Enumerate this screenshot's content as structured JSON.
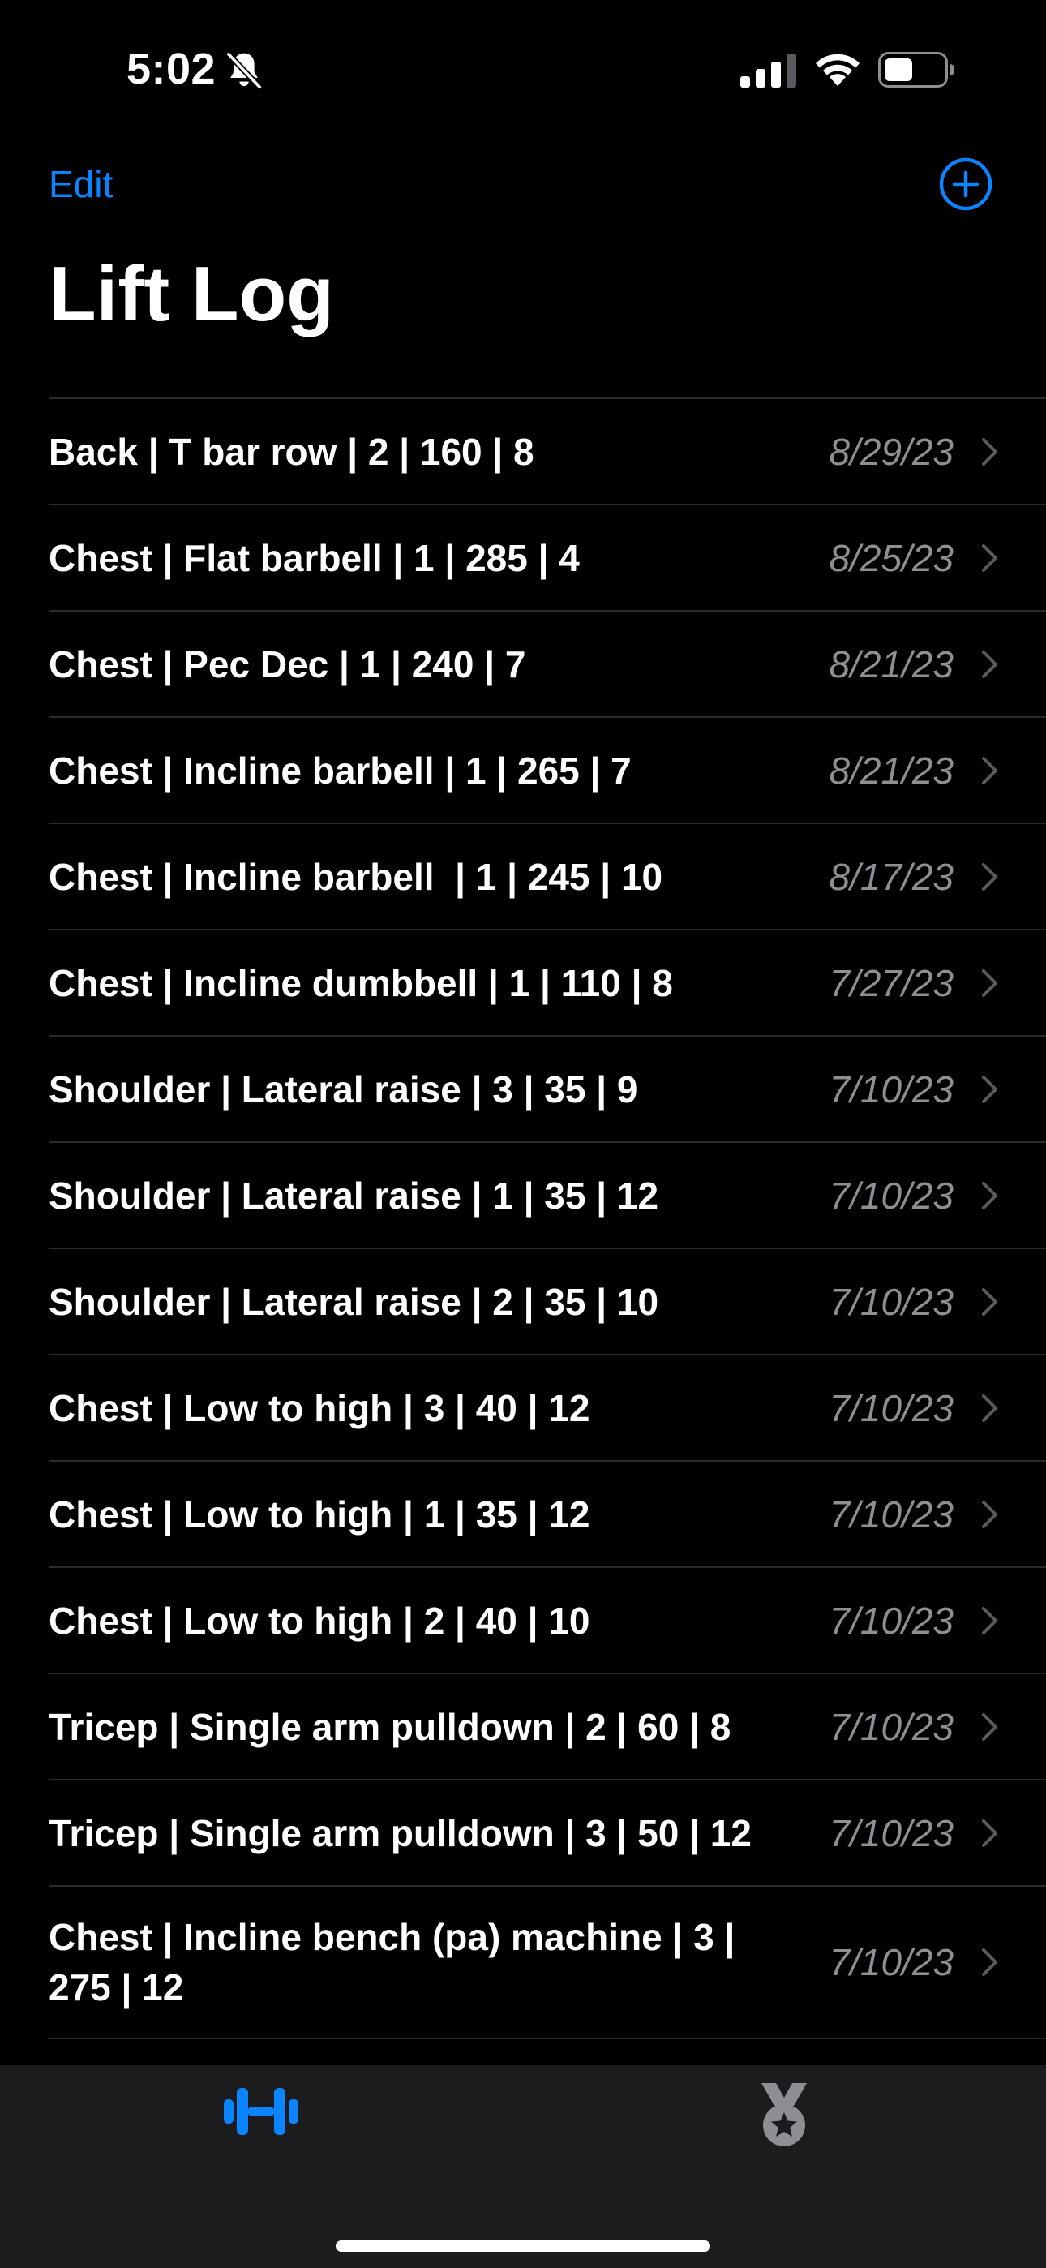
{
  "status_bar": {
    "time": "5:02"
  },
  "nav": {
    "edit_label": "Edit",
    "title": "Lift Log"
  },
  "colors": {
    "accent": "#0a84ff",
    "secondary_text": "#8e8e93",
    "background": "#000000"
  },
  "entries": [
    {
      "title": "Back | T bar row | 2 | 160 | 8",
      "date": "8/29/23"
    },
    {
      "title": "Chest | Flat barbell | 1 | 285 | 4",
      "date": "8/25/23"
    },
    {
      "title": "Chest | Pec Dec | 1 | 240 | 7",
      "date": "8/21/23"
    },
    {
      "title": "Chest | Incline barbell | 1 | 265 | 7",
      "date": "8/21/23"
    },
    {
      "title": "Chest | Incline barbell  | 1 | 245 | 10",
      "date": "8/17/23"
    },
    {
      "title": "Chest | Incline dumbbell | 1 | 110 | 8",
      "date": "7/27/23"
    },
    {
      "title": "Shoulder | Lateral raise | 3 | 35 | 9",
      "date": "7/10/23"
    },
    {
      "title": "Shoulder | Lateral raise | 1 | 35 | 12",
      "date": "7/10/23"
    },
    {
      "title": "Shoulder | Lateral raise | 2 | 35 | 10",
      "date": "7/10/23"
    },
    {
      "title": "Chest | Low to high | 3 | 40 | 12",
      "date": "7/10/23"
    },
    {
      "title": "Chest | Low to high | 1 | 35 | 12",
      "date": "7/10/23"
    },
    {
      "title": "Chest | Low to high | 2 | 40 | 10",
      "date": "7/10/23"
    },
    {
      "title": "Tricep | Single arm pulldown | 2 | 60 | 8",
      "date": "7/10/23"
    },
    {
      "title": "Tricep | Single arm pulldown | 3 | 50 | 12",
      "date": "7/10/23"
    },
    {
      "title": "Chest | Incline bench (pa) machine | 3 | 275 | 12",
      "date": "7/10/23"
    }
  ],
  "tabs": [
    {
      "icon": "dumbbell-icon",
      "selected": true
    },
    {
      "icon": "medal-icon",
      "selected": false
    }
  ]
}
